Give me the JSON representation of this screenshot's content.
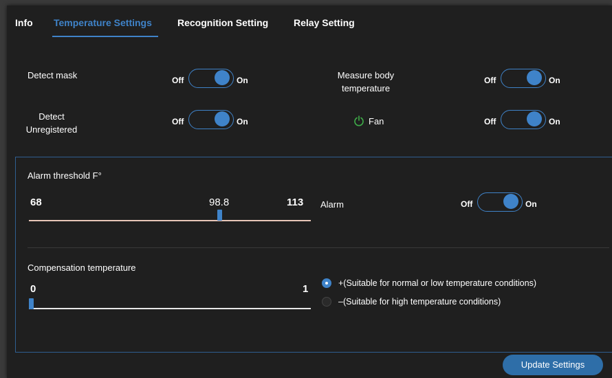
{
  "tabs": [
    {
      "label": "Info"
    },
    {
      "label": "Temperature Settings"
    },
    {
      "label": "Recognition Setting"
    },
    {
      "label": "Relay Setting"
    }
  ],
  "toggle_text": {
    "off": "Off",
    "on": "On"
  },
  "settings": {
    "detect_mask": {
      "label": "Detect mask",
      "state": "on"
    },
    "measure_body_temperature": {
      "label_line1": "Measure body",
      "label_line2": "temperature",
      "state": "on"
    },
    "detect_unregistered": {
      "label_line1": "Detect",
      "label_line2": "Unregistered",
      "state": "on"
    },
    "fan": {
      "label": "Fan",
      "state": "on"
    }
  },
  "alarm_threshold": {
    "label": "Alarm threshold F°",
    "min": "68",
    "value": "98.8",
    "max": "113",
    "fraction": 0.68,
    "alarm_label": "Alarm",
    "alarm_state": "on"
  },
  "compensation": {
    "label": "Compensation temperature",
    "min": "0",
    "max": "1",
    "fraction": 0.0,
    "options": [
      {
        "label": "+(Suitable for normal or low temperature conditions)",
        "checked": true
      },
      {
        "label": "–(Suitable for high temperature conditions)",
        "checked": false
      }
    ]
  },
  "update_button": "Update Settings",
  "colors": {
    "accent": "#3f83c9",
    "panel": "#1f1f1f",
    "fan_icon": "#3fae49"
  }
}
